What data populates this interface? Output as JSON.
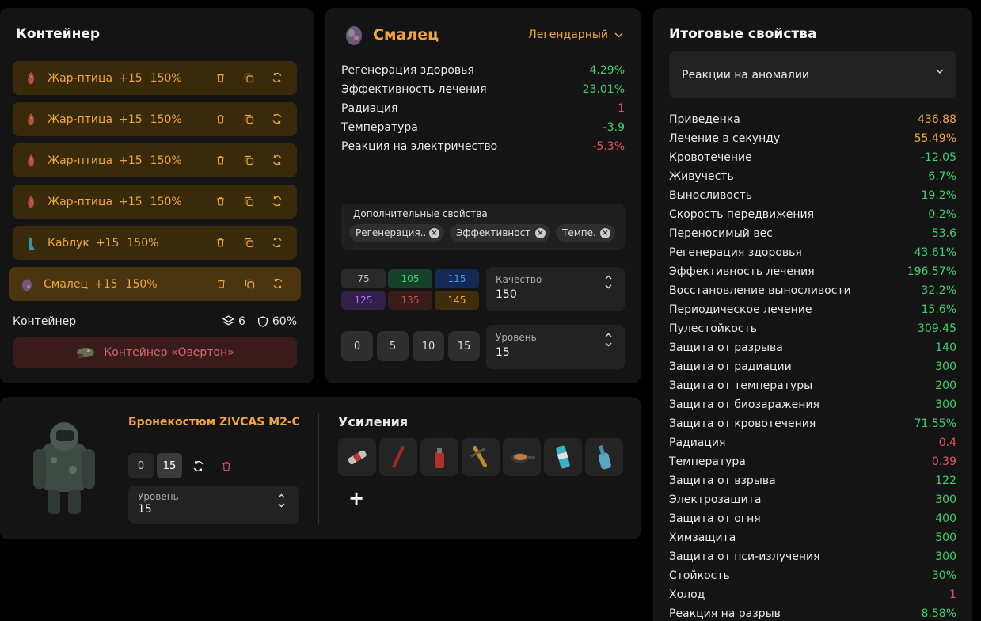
{
  "container": {
    "title": "Контейнер",
    "items": [
      {
        "name": "Жар-птица",
        "plus": "+15",
        "pct": "150%"
      },
      {
        "name": "Жар-птица",
        "plus": "+15",
        "pct": "150%"
      },
      {
        "name": "Жар-птица",
        "plus": "+15",
        "pct": "150%"
      },
      {
        "name": "Жар-птица",
        "plus": "+15",
        "pct": "150%"
      },
      {
        "name": "Каблук",
        "plus": "+15",
        "pct": "150%"
      },
      {
        "name": "Смалец",
        "plus": "+15",
        "pct": "150%"
      }
    ],
    "footer_label": "Контейнер",
    "slots": "6",
    "protection": "60%",
    "container_button": "Контейнер «Овертон»"
  },
  "artifact": {
    "title": "Смалец",
    "rarity": "Легендарный",
    "props": [
      {
        "label": "Регенерация здоровья",
        "value": "4.29%",
        "color": "green"
      },
      {
        "label": "Эффективность лечения",
        "value": "23.01%",
        "color": "green"
      },
      {
        "label": "Радиация",
        "value": "1",
        "color": "red"
      },
      {
        "label": "Температура",
        "value": "-3.9",
        "color": "green"
      },
      {
        "label": "Реакция на электричество",
        "value": "-5.3%",
        "color": "red"
      }
    ],
    "extra_title": "Дополнительные свойства",
    "chips": [
      "Регенерация...",
      "Эффективност...",
      "Темпе..."
    ],
    "quality_cells": [
      {
        "v": "75",
        "bg": "#2a2a2a",
        "fg": "#bbbbbb"
      },
      {
        "v": "105",
        "bg": "#16402a",
        "fg": "#3fd06e"
      },
      {
        "v": "115",
        "bg": "#132a52",
        "fg": "#5b8cff"
      },
      {
        "v": "125",
        "bg": "#33204a",
        "fg": "#b070ff"
      },
      {
        "v": "135",
        "bg": "#3a1c1c",
        "fg": "#c05050"
      },
      {
        "v": "145",
        "bg": "#3e2c0c",
        "fg": "#f0a640"
      }
    ],
    "quality_label": "Качество",
    "quality_value": "150",
    "level_buttons": [
      "0",
      "5",
      "10",
      "15"
    ],
    "level_label": "Уровень",
    "level_value": "15"
  },
  "armor": {
    "name": "Бронекостюм ZIVCAS M2-C",
    "btn_a": "0",
    "btn_b": "15",
    "level_label": "Уровень",
    "level_value": "15",
    "boosts_title": "Усиления",
    "boost_icons": [
      "bandage-icon",
      "stick-icon",
      "spray-icon",
      "syringe-icon",
      "pan-icon",
      "can-icon",
      "bottle-icon"
    ]
  },
  "total": {
    "title": "Итоговые свойства",
    "dropdown": "Реакции на аномалии",
    "rows": [
      {
        "label": "Приведенка",
        "value": "436.88",
        "color": "orange"
      },
      {
        "label": "Лечение в секунду",
        "value": "55.49%",
        "color": "orange"
      },
      {
        "label": "Кровотечение",
        "value": "-12.05",
        "color": "green"
      },
      {
        "label": "Живучесть",
        "value": "6.7%",
        "color": "green"
      },
      {
        "label": "Выносливость",
        "value": "19.2%",
        "color": "green"
      },
      {
        "label": "Скорость передвижения",
        "value": "0.2%",
        "color": "green"
      },
      {
        "label": "Переносимый вес",
        "value": "53.6",
        "color": "green"
      },
      {
        "label": "Регенерация здоровья",
        "value": "43.61%",
        "color": "green"
      },
      {
        "label": "Эффективность лечения",
        "value": "196.57%",
        "color": "green"
      },
      {
        "label": "Восстановление выносливости",
        "value": "32.2%",
        "color": "green"
      },
      {
        "label": "Периодическое лечение",
        "value": "15.6%",
        "color": "green"
      },
      {
        "label": "Пулестойкость",
        "value": "309.45",
        "color": "green"
      },
      {
        "label": "Защита от разрыва",
        "value": "140",
        "color": "green"
      },
      {
        "label": "Защита от радиации",
        "value": "300",
        "color": "green"
      },
      {
        "label": "Защита от температуры",
        "value": "200",
        "color": "green"
      },
      {
        "label": "Защита от биозаражения",
        "value": "300",
        "color": "green"
      },
      {
        "label": "Защита от кровотечения",
        "value": "71.55%",
        "color": "green"
      },
      {
        "label": "Радиация",
        "value": "0.4",
        "color": "red"
      },
      {
        "label": "Температура",
        "value": "0.39",
        "color": "red"
      },
      {
        "label": "Защита от взрыва",
        "value": "122",
        "color": "green"
      },
      {
        "label": "Электрозащита",
        "value": "300",
        "color": "green"
      },
      {
        "label": "Защита от огня",
        "value": "400",
        "color": "green"
      },
      {
        "label": "Химзащита",
        "value": "500",
        "color": "green"
      },
      {
        "label": "Защита от пси-излучения",
        "value": "300",
        "color": "green"
      },
      {
        "label": "Стойкость",
        "value": "30%",
        "color": "green"
      },
      {
        "label": "Холод",
        "value": "1",
        "color": "red"
      },
      {
        "label": "Реакция на разрыв",
        "value": "8.58%",
        "color": "green"
      }
    ]
  }
}
